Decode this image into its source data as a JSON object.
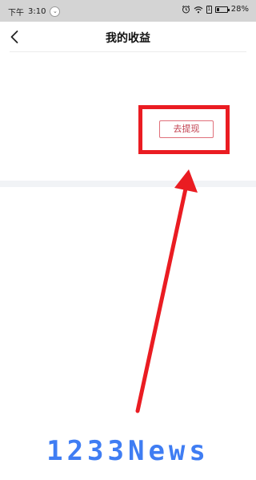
{
  "status_bar": {
    "period": "下午",
    "time": "3:10",
    "notification_icon": "chevron-down-icon",
    "sim_label": "1",
    "battery_percent": "28%",
    "battery_level": 0.28,
    "icons": [
      "alarm-icon",
      "wifi-icon",
      "sim-icon",
      "battery-icon"
    ]
  },
  "nav": {
    "title": "我的收益",
    "back_icon": "chevron-left-icon"
  },
  "main": {
    "withdraw_label": "去提现"
  },
  "annotation": {
    "highlight_color": "#ea1c22",
    "arrow_color": "#ea1c22"
  },
  "watermark": {
    "text": "1233News"
  },
  "colors": {
    "status_bar_bg": "#d4d4d4",
    "withdraw_border": "#e0707a",
    "withdraw_text": "#c2404f",
    "separator": "#f1f3f6",
    "watermark": "#3f7df3"
  }
}
